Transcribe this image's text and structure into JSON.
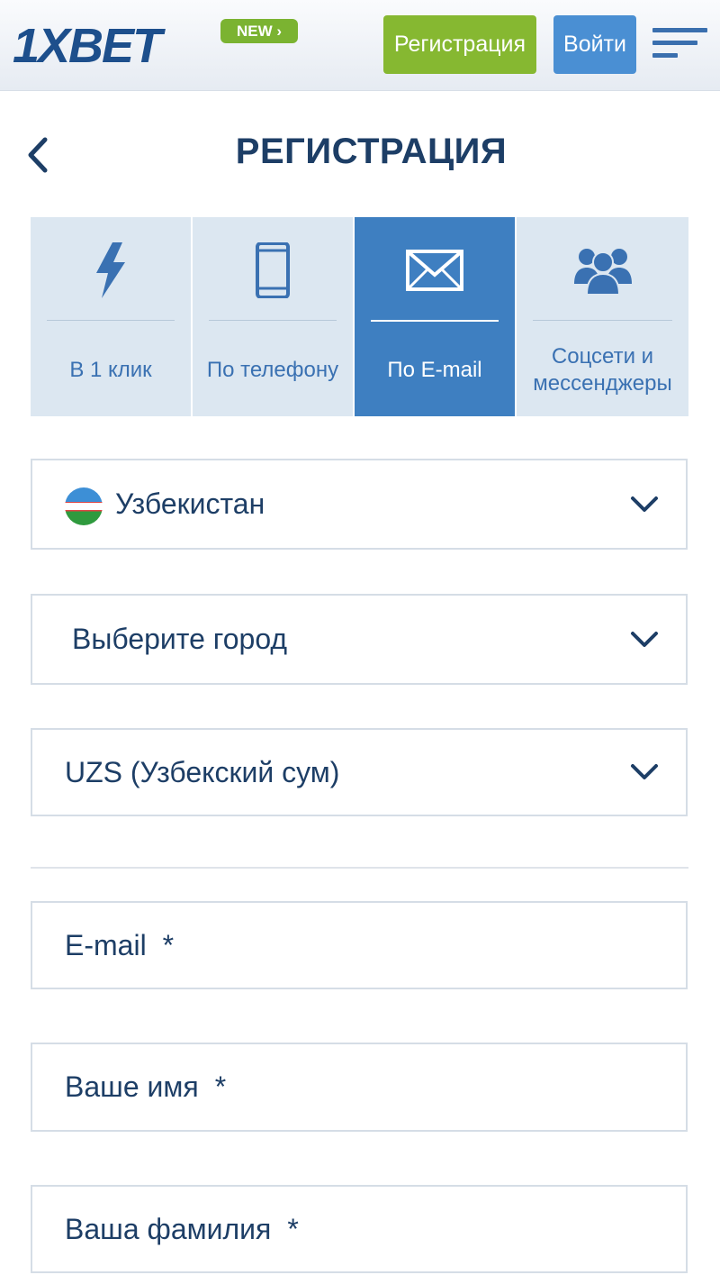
{
  "header": {
    "logo_text": "1XBET",
    "new_badge": "NEW ›",
    "register_label": "Регистрация",
    "login_label": "Войти"
  },
  "page": {
    "title": "РЕГИСТРАЦИЯ"
  },
  "tabs": [
    {
      "label": "В 1 клик",
      "icon": "lightning-icon",
      "active": false
    },
    {
      "label": "По телефону",
      "icon": "phone-icon",
      "active": false
    },
    {
      "label": "По E-mail",
      "icon": "envelope-icon",
      "active": true
    },
    {
      "label": "Соцсети и\nмессенджеры",
      "icon": "group-icon",
      "active": false
    }
  ],
  "form": {
    "country": "Узбекистан",
    "city_placeholder": "Выберите город",
    "currency": "UZS (Узбекский сум)",
    "email_placeholder": "E-mail",
    "first_name_placeholder": "Ваше имя",
    "last_name_placeholder": "Ваша фамилия",
    "required_mark": "*"
  },
  "colors": {
    "brand_dark": "#1d3e66",
    "register_green": "#86b831",
    "login_blue": "#4a8fd3",
    "tab_active": "#3e7fc1",
    "tab_inactive": "#dce7f1"
  }
}
